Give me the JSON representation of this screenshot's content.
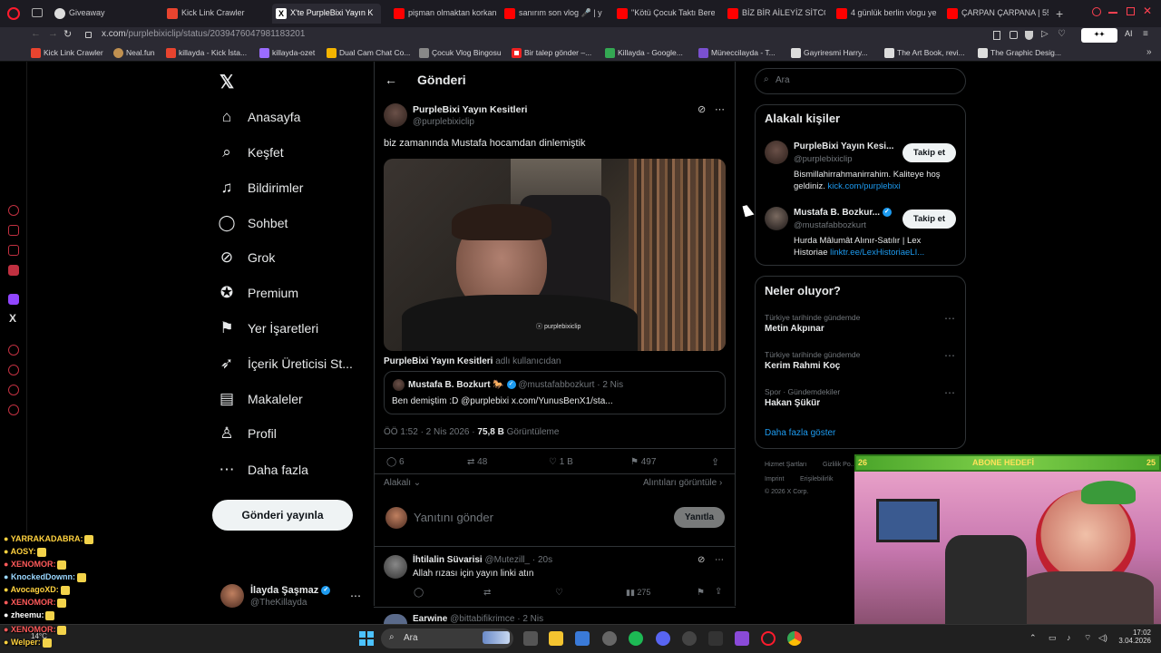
{
  "browser": {
    "tabs": [
      {
        "label": "Giveaway",
        "icon": "giveaway-icon"
      },
      {
        "label": "Kick Link Crawler",
        "icon": "kick-icon"
      },
      {
        "label": "X'te PurpleBixi Yayın K",
        "icon": "x-icon"
      },
      {
        "label": "pişman olmaktan korkan",
        "icon": "youtube-icon"
      },
      {
        "label": "sanırım son vlog 🎤 | yen",
        "icon": "youtube-icon"
      },
      {
        "label": "\"Kötü Çocuk Taktı Beres",
        "icon": "youtube-icon"
      },
      {
        "label": "BİZ BİR AİLEYİZ SİTCOM",
        "icon": "youtube-icon"
      },
      {
        "label": "4 günlük berlin vlogu ye",
        "icon": "youtube-icon"
      },
      {
        "label": "ÇARPAN ÇARPANA | 55r",
        "icon": "youtube-icon"
      }
    ],
    "url_host": "x.com",
    "url_path": "/purplebixiclip/status/2039476047981183201",
    "bookmarks": [
      "Kick Link Crawler",
      "Neal.fun",
      "killayda - Kick İsta...",
      "killayda-ozet",
      "Dual Cam Chat Co...",
      "Çocuk Vlog Bingosu",
      "Bir talep gönder –...",
      "Killayda - Google...",
      "Müneccilayda - T...",
      "Gayriresmi Harry...",
      "The Art Book, revi...",
      "The Graphic Desig..."
    ],
    "ext_badge": "AI"
  },
  "nav": {
    "items": [
      {
        "label": "Anasayfa",
        "icon": "home-icon"
      },
      {
        "label": "Keşfet",
        "icon": "search-icon"
      },
      {
        "label": "Bildirimler",
        "icon": "bell-icon"
      },
      {
        "label": "Sohbet",
        "icon": "chat-icon"
      },
      {
        "label": "Grok",
        "icon": "grok-icon"
      },
      {
        "label": "Premium",
        "icon": "premium-icon"
      },
      {
        "label": "Yer İşaretleri",
        "icon": "bookmark-icon"
      },
      {
        "label": "İçerik Üreticisi St...",
        "icon": "rocket-icon"
      },
      {
        "label": "Makaleler",
        "icon": "articles-icon"
      },
      {
        "label": "Profil",
        "icon": "profile-icon"
      },
      {
        "label": "Daha fazla",
        "icon": "more-icon"
      }
    ],
    "post_button": "Gönderi yayınla",
    "account": {
      "name": "İlayda Şaşmaz",
      "handle": "@TheKillayda"
    }
  },
  "post": {
    "header_title": "Gönderi",
    "author_name": "PurpleBixi Yayın Kesitleri",
    "author_handle": "@purplebixiclip",
    "text": "biz zamanında Mustafa hocamdan dinlemiştik",
    "video_watermark": "purplebixiclip",
    "attribution_name": "PurpleBixi Yayın Kesitleri",
    "attribution_suffix": "adlı kullanıcıdan",
    "quote": {
      "name": "Mustafa B. Bozkurt",
      "handle": "@mustafabbozkurt",
      "date": "2 Nis",
      "text": "Ben demiştim :D @purplebixi x.com/YunusBenX1/sta..."
    },
    "meta_time": "ÖÖ 1:52 · 2 Nis 2026 · ",
    "views_count": "75,8 B",
    "views_label": "Görüntüleme",
    "replies": "6",
    "reposts": "48",
    "likes": "1 B",
    "bookmarks": "497",
    "sort_label": "Alakalı",
    "quotes_link": "Alıntıları görüntüle",
    "reply_placeholder": "Yanıtını gönder",
    "reply_button": "Yanıtla"
  },
  "replies": [
    {
      "name": "İhtilalin Süvarisi",
      "handle": "@Mutezill_",
      "date": "20s",
      "text": "Allah rızası için yayın linki atın",
      "views": "275"
    },
    {
      "name": "Earwine",
      "handle": "@bittabifikrimce",
      "date": "2 Nis",
      "text": "",
      "views": ""
    }
  ],
  "sidebar": {
    "search_placeholder": "Ara",
    "who_to_follow_title": "Alakalı kişiler",
    "people": [
      {
        "name": "PurpleBixi Yayın Kesi...",
        "handle": "@purplebixiclip",
        "bio": "Bismillahirrahmanirrahim. Kaliteye hoş geldiniz. ",
        "link": "kick.com/purplebixi",
        "button": "Takip et"
      },
      {
        "name": "Mustafa B. Bozkur...",
        "handle": "@mustafabbozkurt",
        "bio": "Hurda Mâlumât Alınır-Satılır | Lex Historiae ",
        "link": "linktr.ee/LexHistoriaeLI...",
        "button": "Takip et"
      }
    ],
    "trends_title": "Neler oluyor?",
    "trends": [
      {
        "context": "Türkiye tarihinde gündemde",
        "name": "Metin Akpınar"
      },
      {
        "context": "Türkiye tarihinde gündemde",
        "name": "Kerim Rahmi Koç"
      },
      {
        "context": "Spor · Gündemdekiler",
        "name": "Hakan Şükür"
      }
    ],
    "show_more": "Daha fazla göster",
    "footer": [
      "Hizmet Şartları",
      "Gizlilik Po...",
      "Imprint",
      "Erişilebilirlik",
      "© 2026 X Corp."
    ]
  },
  "stream": {
    "goal_label": "ABONE HEDEFİ",
    "goal_current": "26",
    "goal_target": "25",
    "chat": [
      {
        "user": "YARRAKADABRA:",
        "color": "#ffd23f"
      },
      {
        "user": "AOSY:",
        "color": "#ffd23f"
      },
      {
        "user": "XENOMOR:",
        "color": "#ff5a5a"
      },
      {
        "user": "KnockedDownn:",
        "color": "#9ad7ff"
      },
      {
        "user": "AvocagoXD:",
        "color": "#ffd23f"
      },
      {
        "user": "XENOMOR:",
        "color": "#ff5a5a"
      },
      {
        "user": "zheemu:",
        "color": "#ffffff"
      },
      {
        "user": "XENOMOR:",
        "color": "#ff5a5a"
      },
      {
        "user": "Welper:",
        "color": "#ffd23f"
      }
    ]
  },
  "taskbar": {
    "search_placeholder": "Ara",
    "weather": "14°C",
    "time": "17:02",
    "date": "3.04.2026"
  },
  "colors": {
    "background": "#000000",
    "accent_blue": "#1d9bf0",
    "browser_red": "#ff1b2d",
    "stream_green": "#5fbf3a"
  }
}
